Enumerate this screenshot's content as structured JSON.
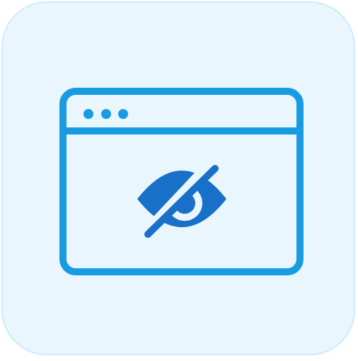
{
  "icon": {
    "name": "hidden-window-icon",
    "parts": [
      "browser-window-icon",
      "eye-slash-icon"
    ]
  },
  "colors": {
    "tile_background": "#e9f6fe",
    "tile_border": "#cdeafc",
    "window_stroke": "#189be0",
    "eye_fill": "#1870c8",
    "background": "#ffffff"
  }
}
